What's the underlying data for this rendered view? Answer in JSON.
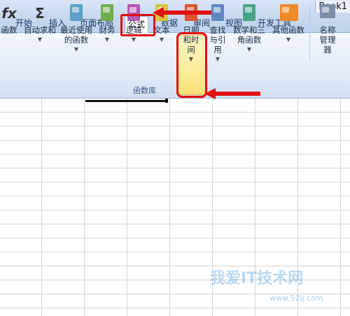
{
  "window": {
    "title": "Book1"
  },
  "tabs": [
    "开始",
    "插入",
    "页面布局",
    "公式",
    "数据",
    "审阅",
    "视图",
    "开发工具"
  ],
  "active_tab": "公式",
  "ribbon": {
    "buttons": [
      {
        "label": "函数",
        "icon": "insert-function-icon"
      },
      {
        "label": "自动求和",
        "icon": "sigma-icon"
      },
      {
        "label": "最近使用的函数",
        "icon": "recent-functions-book-icon"
      },
      {
        "label": "财务",
        "icon": "financial-book-icon"
      },
      {
        "label": "逻辑",
        "icon": "logical-book-icon"
      },
      {
        "label": "文本",
        "icon": "text-book-icon"
      },
      {
        "label": "日期和时间",
        "icon": "datetime-book-icon"
      },
      {
        "label": "查找与引用",
        "icon": "lookup-book-icon"
      },
      {
        "label": "数学和三角函数",
        "icon": "math-book-icon"
      },
      {
        "label": "其他函数",
        "icon": "more-functions-book-icon"
      },
      {
        "label": "名称管理器",
        "icon": "name-manager-icon"
      }
    ],
    "group_label": "函数库"
  },
  "watermark": {
    "main": "我爱IT技术网",
    "url": "www.52ij.com"
  },
  "colors": {
    "annotation": "#e01010",
    "highlight": "#fde27a",
    "ribbon": "#dfe9f7"
  }
}
